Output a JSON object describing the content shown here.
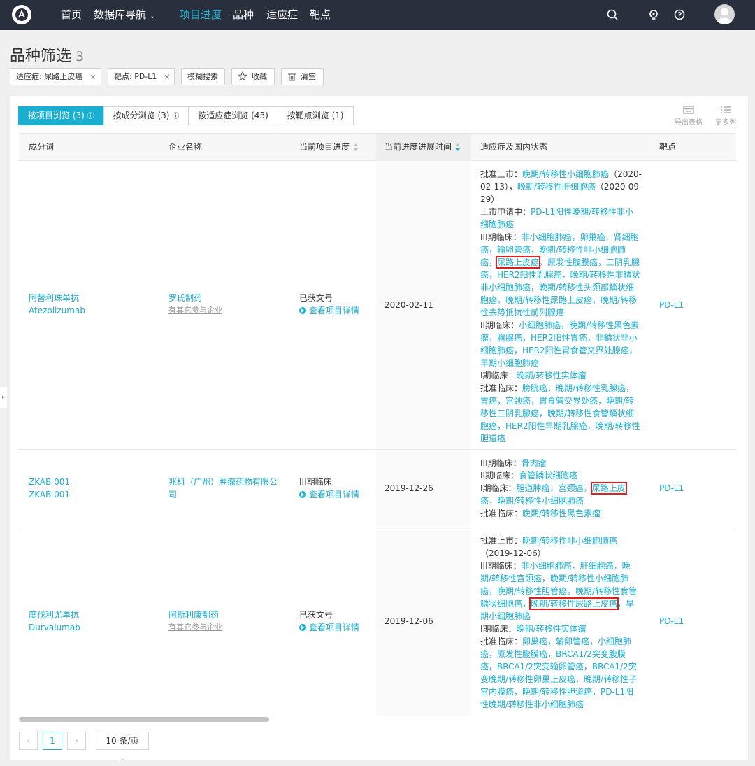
{
  "nav": {
    "items": [
      "首页",
      "数据库导航",
      "项目进度",
      "品种",
      "适应症",
      "靶点"
    ],
    "active_index": 2,
    "dropdown_index": 1
  },
  "header": {
    "title": "品种筛选",
    "count": "3"
  },
  "filters": {
    "chip1": "适应症: 尿路上皮癌",
    "chip2": "靶点: PD-L1",
    "fuzzy": "模糊搜索",
    "favorite": "收藏",
    "clear": "清空",
    "close": "×"
  },
  "tabs": [
    "按项目浏览 (3)",
    "按成分浏览 (3)",
    "按适应症浏览 (43)",
    "按靶点浏览 (1)"
  ],
  "tools": {
    "export": "导出表格",
    "more": "更多列"
  },
  "table": {
    "headers": [
      "成分词",
      "企业名称",
      "当前项目进度",
      "当前进度进展时间",
      "适应症及国内状态",
      "靶点"
    ],
    "detail_link": "查看项目详情",
    "rows": [
      {
        "name_cn": "阿替利珠单抗",
        "name_en": "Atezolizumab",
        "company": "罗氏制药",
        "company_sub": "有其它参与企业",
        "progress": "已获文号",
        "date": "2020-02-11",
        "target": "PD-L1",
        "status_lines": [
          [
            [
              "批准上市：",
              "l"
            ],
            [
              "晚期/转移性小细胞肺癌",
              "v"
            ],
            [
              "（2020-",
              "l"
            ]
          ],
          [
            [
              "02-13），",
              "l"
            ],
            [
              "晚期/转移性肝细胞癌",
              "v"
            ],
            [
              "（2020-09-",
              "l"
            ]
          ],
          [
            [
              "29）",
              "l"
            ]
          ],
          [
            [
              "上市申请中：",
              "l"
            ],
            [
              "PD-L1阳性晚期/转移性非小",
              "v"
            ]
          ],
          [
            [
              "细胞肺癌",
              "v"
            ]
          ],
          [
            [
              "III期临床：",
              "l"
            ],
            [
              "非小细胞肺癌，卵巢癌，肾细胞",
              "v"
            ]
          ],
          [
            [
              "癌，输卵管癌，晚期/转移性非小细胞肺",
              "v"
            ]
          ],
          [
            [
              "癌，",
              "v"
            ],
            [
              "尿路上皮癌",
              "h"
            ],
            [
              "，原发性腹膜癌，三阴乳腺",
              "v"
            ]
          ],
          [
            [
              "癌，HER2阳性乳腺癌，晚期/转移性非鳞状",
              "v"
            ]
          ],
          [
            [
              "非小细胞肺癌，晚期/转移性头颈部鳞状细",
              "v"
            ]
          ],
          [
            [
              "胞癌，晚期/转移性尿路上皮癌，晚期/转移",
              "v"
            ]
          ],
          [
            [
              "性去势抵抗性前列腺癌",
              "v"
            ]
          ],
          [
            [
              "II期临床：",
              "l"
            ],
            [
              "小细胞肺癌，晚期/转移性黑色素",
              "v"
            ]
          ],
          [
            [
              "瘤，胸腺癌，HER2阳性胃癌，非鳞状非小",
              "v"
            ]
          ],
          [
            [
              "细胞肺癌，HER2阳性胃食管交界处腺癌，",
              "v"
            ]
          ],
          [
            [
              "早期小细胞肺癌",
              "v"
            ]
          ],
          [
            [
              "I期临床：",
              "l"
            ],
            [
              "晚期/转移性实体瘤",
              "v"
            ]
          ],
          [
            [
              "批准临床：",
              "l"
            ],
            [
              "膀胱癌，晚期/转移性乳腺癌，",
              "v"
            ]
          ],
          [
            [
              "胃癌，宫颈癌，胃食管交界处癌，晚期/转",
              "v"
            ]
          ],
          [
            [
              "移性三阴乳腺癌，晚期/转移性食管鳞状细",
              "v"
            ]
          ],
          [
            [
              "胞癌，HER2阳性早期乳腺癌，晚期/转移性",
              "v"
            ]
          ],
          [
            [
              "胆道癌",
              "v"
            ]
          ]
        ]
      },
      {
        "name_cn": "ZKAB 001",
        "name_en": "ZKAB 001",
        "company": "兆科（广州）肿瘤药物有限公",
        "company2": "司",
        "progress": "III期临床",
        "date": "2019-12-26",
        "target": "PD-L1",
        "status_lines": [
          [
            [
              "III期临床：",
              "l"
            ],
            [
              "骨肉瘤",
              "v"
            ]
          ],
          [
            [
              "II期临床：",
              "l"
            ],
            [
              "食管鳞状细胞癌",
              "v"
            ]
          ],
          [
            [
              "I期临床：",
              "l"
            ],
            [
              "胆道肿瘤，宫颈癌，",
              "v"
            ],
            [
              "尿路上皮",
              "h"
            ]
          ],
          [
            [
              "癌，晚期/转移性小细胞肺癌",
              "v"
            ]
          ],
          [
            [
              "批准临床：",
              "l"
            ],
            [
              "晚期/转移性黑色素瘤",
              "v"
            ]
          ]
        ]
      },
      {
        "name_cn": "度伐利尤单抗",
        "name_en": "Durvalumab",
        "company": "阿斯利康制药",
        "company_sub": "有其它参与企业",
        "progress": "已获文号",
        "date": "2019-12-06",
        "target": "PD-L1",
        "status_lines": [
          [
            [
              "批准上市：",
              "l"
            ],
            [
              "晚期/转移性非小细胞肺癌",
              "v"
            ]
          ],
          [
            [
              "（2019-12-06）",
              "l"
            ]
          ],
          [
            [
              "III期临床：",
              "l"
            ],
            [
              "非小细胞肺癌，肝细胞癌，晚",
              "v"
            ]
          ],
          [
            [
              "期/转移性宫颈癌，晚期/转移性小细胞肺",
              "v"
            ]
          ],
          [
            [
              "癌，晚期/转移性胆管癌，晚期/转移性食管",
              "v"
            ]
          ],
          [
            [
              "鳞状细胞癌，",
              "v"
            ],
            [
              "晚期/转移性尿路上皮癌",
              "h"
            ],
            [
              "，早",
              "v"
            ]
          ],
          [
            [
              "期小细胞肺癌",
              "v"
            ]
          ],
          [
            [
              "I期临床：",
              "l"
            ],
            [
              "晚期/转移性实体瘤",
              "v"
            ]
          ],
          [
            [
              "批准临床：",
              "l"
            ],
            [
              "卵巢癌，输卵管癌，小细胞肺",
              "v"
            ]
          ],
          [
            [
              "癌，原发性腹膜癌，BRCA1/2突变腹膜",
              "v"
            ]
          ],
          [
            [
              "癌，BRCA1/2突变输卵管癌，BRCA1/2突",
              "v"
            ]
          ],
          [
            [
              "变晚期/转移性卵巢上皮癌，晚期/转移性子",
              "v"
            ]
          ],
          [
            [
              "宫内膜癌，晚期/转移性胆道癌，PD-L1阳",
              "v"
            ]
          ],
          [
            [
              "性晚期/转移性非小细胞肺癌",
              "v"
            ]
          ]
        ]
      }
    ]
  },
  "pagination": {
    "prev": "‹",
    "current": "1",
    "next": "›",
    "page_size": "10 条/页"
  }
}
